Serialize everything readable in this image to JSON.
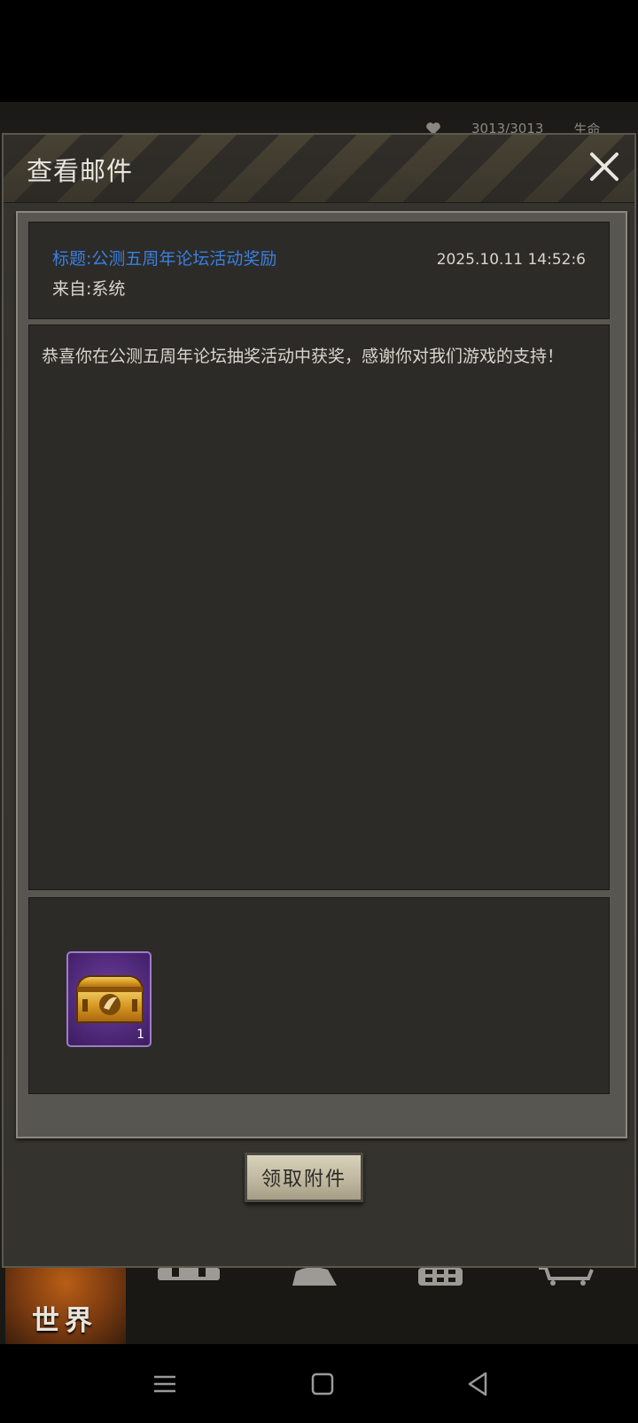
{
  "hud": {
    "hp": "3013/3013",
    "label": "生命"
  },
  "dialog": {
    "title": "查看邮件",
    "close_icon": "close-icon"
  },
  "mail": {
    "subject": "标题:公测五周年论坛活动奖励",
    "from": "来自:系统",
    "time": "2025.10.11 14:52:6",
    "body": "恭喜你在公测五周年论坛抽奖活动中获奖，感谢你对我们游戏的支持！"
  },
  "attachment": {
    "icon": "treasure-chest-icon",
    "count": "1",
    "border_color": "#9d7cc9"
  },
  "actions": {
    "claim_label": "领取附件"
  },
  "game_nav": {
    "world_label": "世界",
    "items": [
      "world-icon",
      "backpack-icon",
      "character-icon",
      "phone-icon",
      "shop-cart-icon"
    ]
  },
  "system_nav": {
    "buttons": [
      "menu-icon",
      "home-icon",
      "back-icon"
    ]
  },
  "colors": {
    "subject_blue": "#3a7fe0",
    "panel_dark": "#2c2b28",
    "frame": "#585650"
  }
}
